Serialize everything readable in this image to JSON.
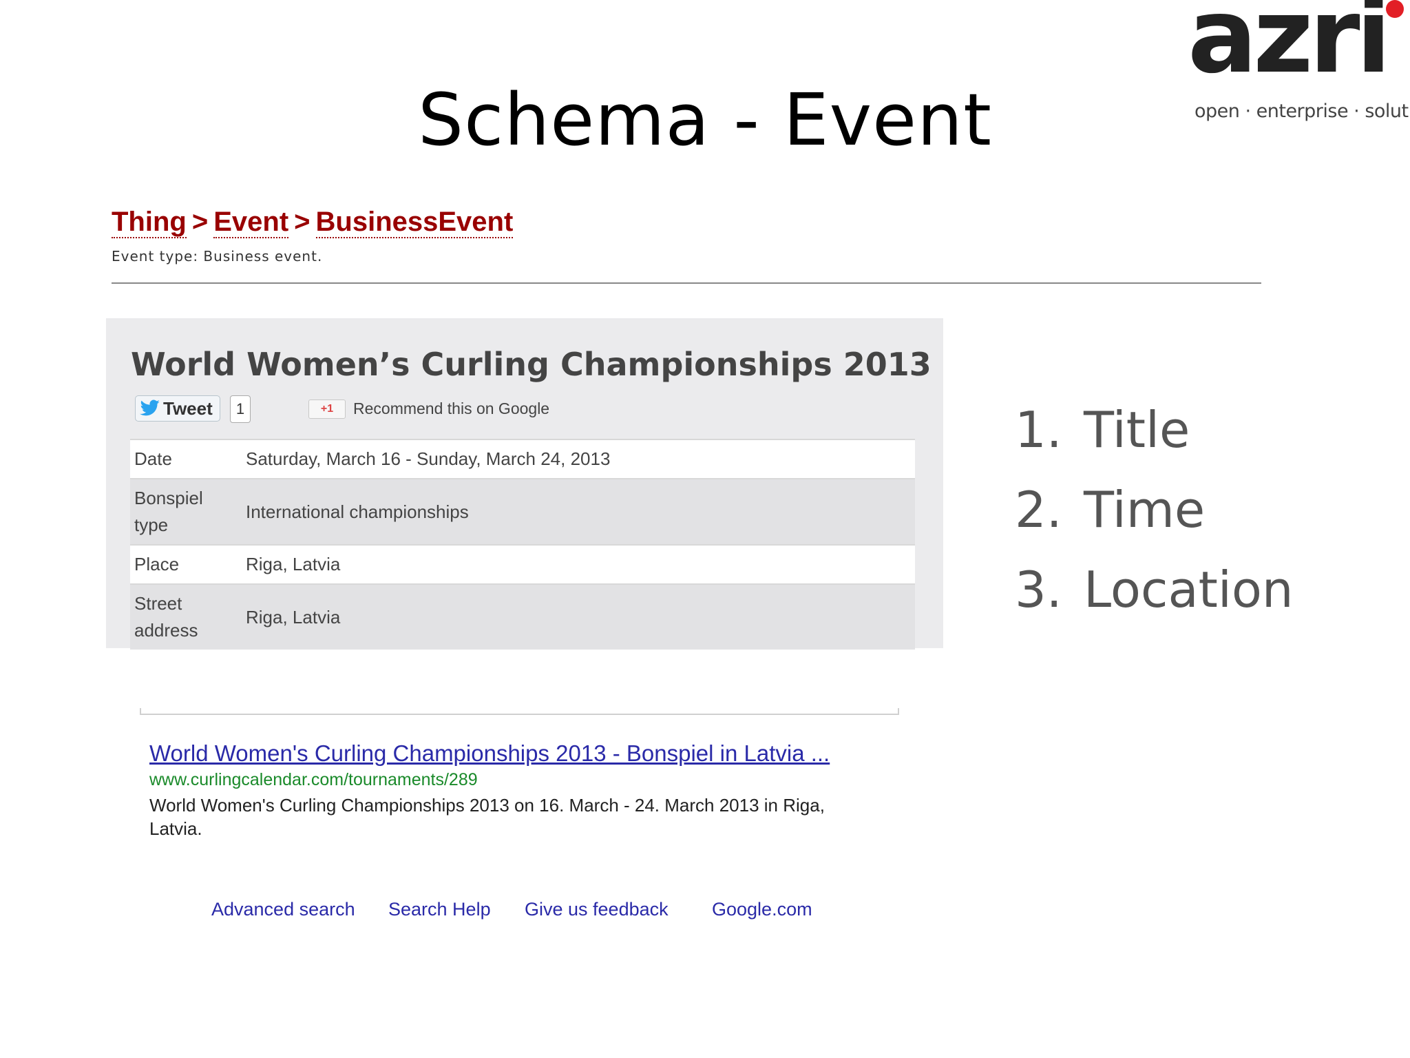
{
  "slide": {
    "title": "Schema - Event"
  },
  "logo": {
    "word": "azri",
    "tagline": "open · enterprise · solutions"
  },
  "breadcrumb": {
    "items": [
      "Thing",
      "Event",
      "BusinessEvent"
    ],
    "separator": ">",
    "event_type": "Event type: Business event."
  },
  "event": {
    "title": "World Women’s Curling Championships 2013",
    "tweet_label": "Tweet",
    "tweet_count": "1",
    "gplus_label": "+1",
    "recommend_text": "Recommend this on Google",
    "rows": [
      {
        "label": "Date",
        "value": "Saturday, March 16 - Sunday, March 24, 2013"
      },
      {
        "label": "Bonspiel type",
        "value": "International championships"
      },
      {
        "label": "Place",
        "value": "Riga, Latvia"
      },
      {
        "label": "Street address",
        "value": "Riga, Latvia"
      }
    ]
  },
  "serp": {
    "title": "World Women's Curling Championships 2013 - Bonspiel in Latvia ...",
    "url": "www.curlingcalendar.com/tournaments/289",
    "snippet": "World Women's Curling Championships 2013 on 16. March - 24. March 2013 in Riga, Latvia."
  },
  "footer": {
    "links": [
      "Advanced search",
      "Search Help",
      "Give us feedback",
      "Google.com"
    ]
  },
  "list": {
    "items": [
      {
        "num": "1.",
        "label": "Title"
      },
      {
        "num": "2.",
        "label": "Time"
      },
      {
        "num": "3.",
        "label": "Location"
      }
    ]
  },
  "colors": {
    "breadcrumb": "#990000",
    "link": "#2a2aa8",
    "url": "#1a8a2a",
    "logo_dot": "#e21f26"
  }
}
